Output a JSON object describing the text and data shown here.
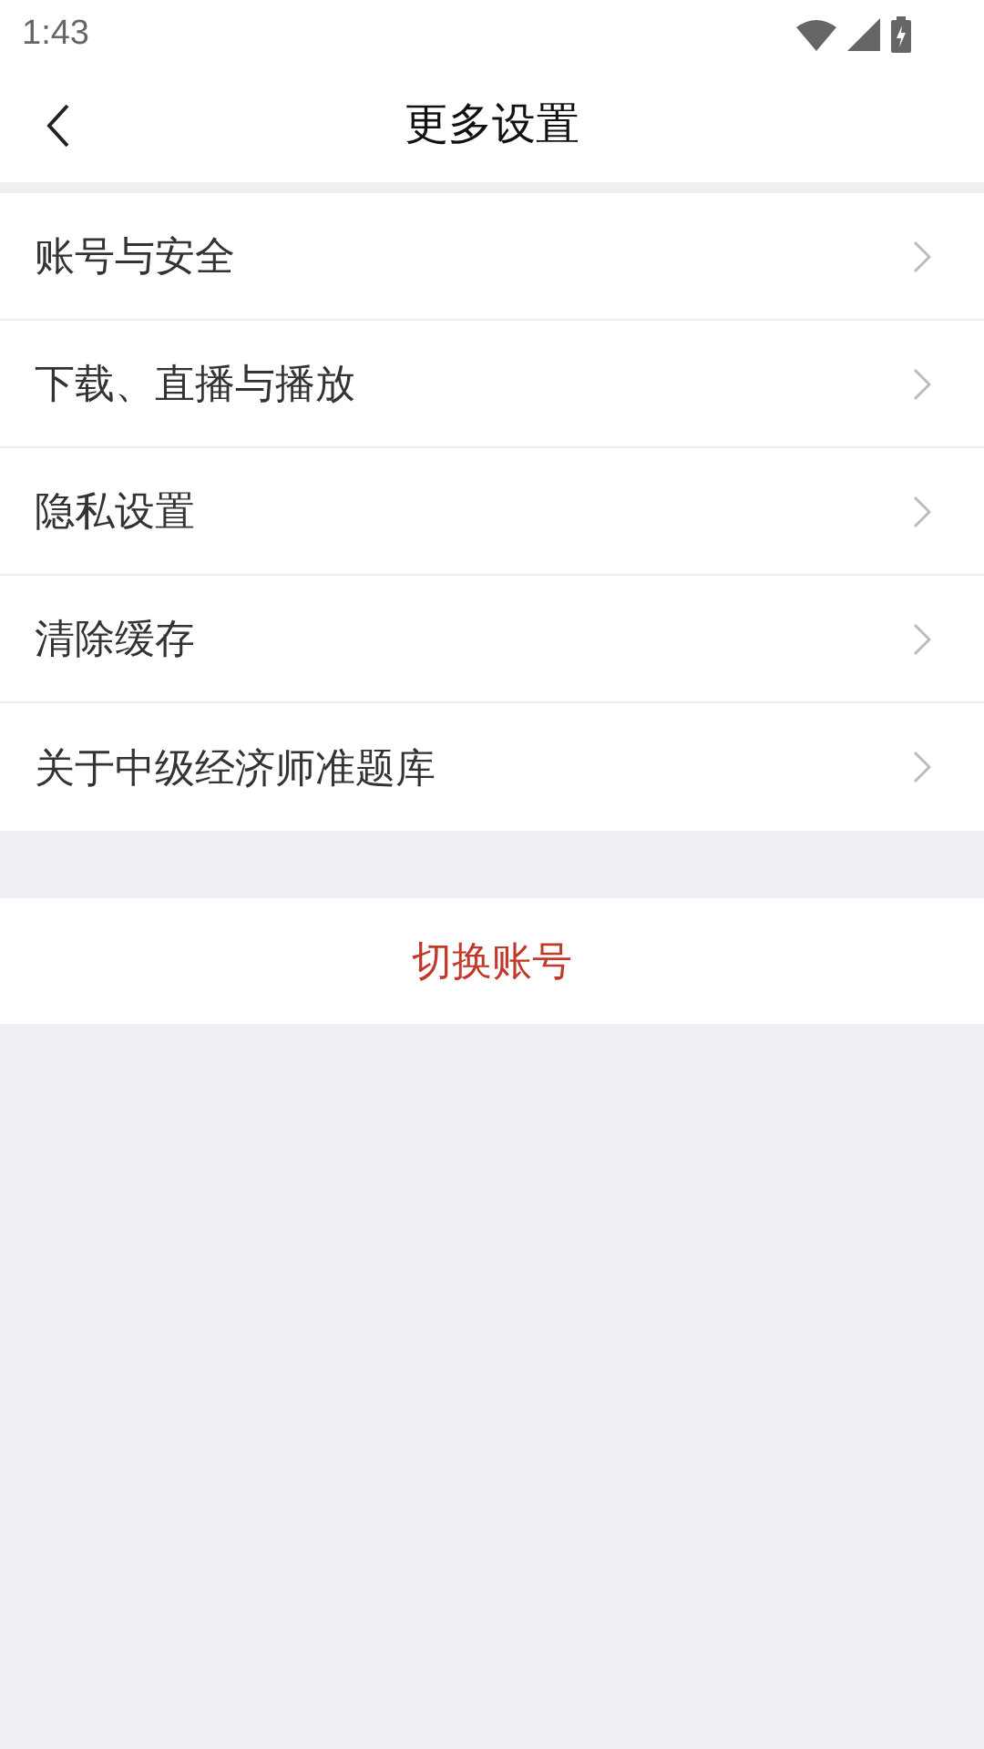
{
  "status_bar": {
    "time": "1:43"
  },
  "header": {
    "title": "更多设置"
  },
  "menu_items": [
    {
      "label": "账号与安全"
    },
    {
      "label": "下载、直播与播放"
    },
    {
      "label": "隐私设置"
    },
    {
      "label": "清除缓存"
    },
    {
      "label": "关于中级经济师准题库"
    }
  ],
  "switch_account": {
    "label": "切换账号"
  }
}
